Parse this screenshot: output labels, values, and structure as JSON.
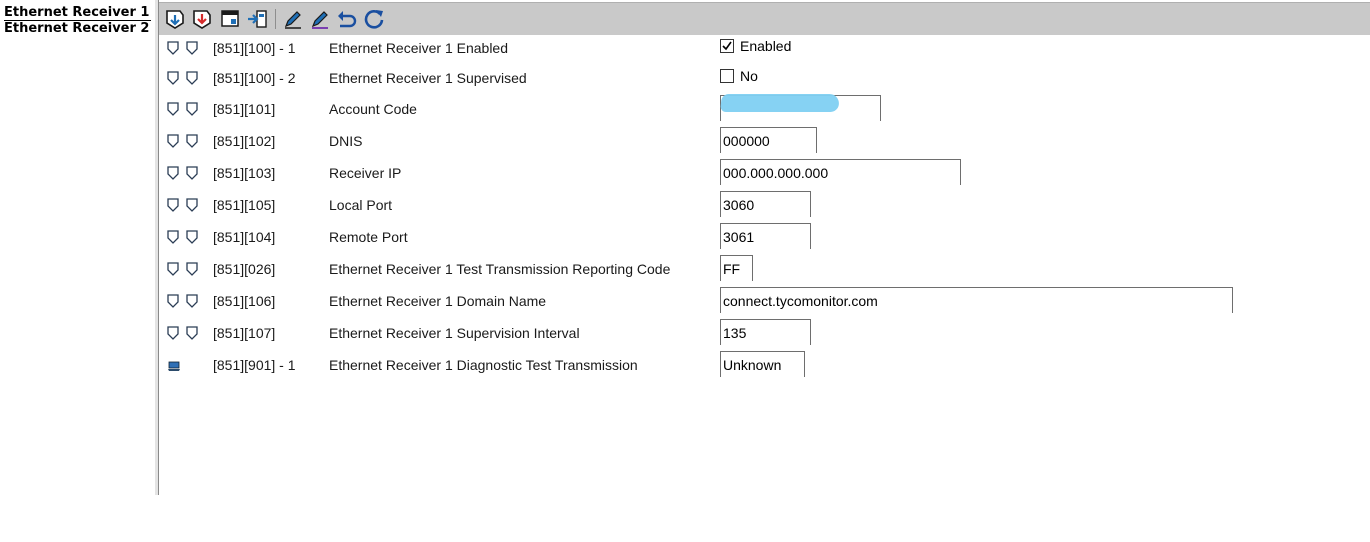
{
  "tree": {
    "items": [
      {
        "label": "Ethernet Receiver 1",
        "selected": true
      },
      {
        "label": "Ethernet Receiver 2",
        "selected": false
      }
    ]
  },
  "toolbar": {
    "buttons": [
      {
        "icon": "download-icon"
      },
      {
        "icon": "upload-icon"
      },
      {
        "icon": "window-icon"
      },
      {
        "icon": "transfer-icon"
      },
      {
        "icon": "edit-pencil-icon"
      },
      {
        "icon": "edit-pencil-alt-icon"
      },
      {
        "icon": "undo-icon"
      },
      {
        "icon": "refresh-icon"
      }
    ]
  },
  "colors": {
    "toolbar_bg": "#c9c9c9",
    "icon_blue": "#1f6fb6",
    "icon_red": "#d52b2b",
    "blur_mask": "#7fd0f2"
  },
  "rows": [
    {
      "code": "[851][100] - 1",
      "label": "Ethernet Receiver 1 Enabled",
      "type": "checkbox",
      "checked": true,
      "value": "Enabled"
    },
    {
      "code": "[851][100] - 2",
      "label": "Ethernet Receiver 1 Supervised",
      "type": "checkbox",
      "checked": false,
      "value": "No"
    },
    {
      "code": "[851][101]",
      "label": "Account Code",
      "type": "text",
      "value": "",
      "redacted": true
    },
    {
      "code": "[851][102]",
      "label": "DNIS",
      "type": "text",
      "value": "000000"
    },
    {
      "code": "[851][103]",
      "label": "Receiver IP",
      "type": "text",
      "value": "000.000.000.000"
    },
    {
      "code": "[851][105]",
      "label": "Local Port",
      "type": "text",
      "value": "3060"
    },
    {
      "code": "[851][104]",
      "label": "Remote Port",
      "type": "text",
      "value": "3061"
    },
    {
      "code": "[851][026]",
      "label": "Ethernet Receiver 1 Test Transmission Reporting Code",
      "type": "text",
      "value": "FF"
    },
    {
      "code": "[851][106]",
      "label": "Ethernet Receiver 1 Domain Name",
      "type": "text",
      "value": "connect.tycomonitor.com"
    },
    {
      "code": "[851][107]",
      "label": "Ethernet Receiver 1 Supervision Interval",
      "type": "text",
      "value": "135"
    },
    {
      "code": "[851][901] - 1",
      "label": "Ethernet Receiver 1 Diagnostic Test Transmission",
      "type": "text",
      "value": "Unknown",
      "icon": "computer-icon"
    }
  ]
}
